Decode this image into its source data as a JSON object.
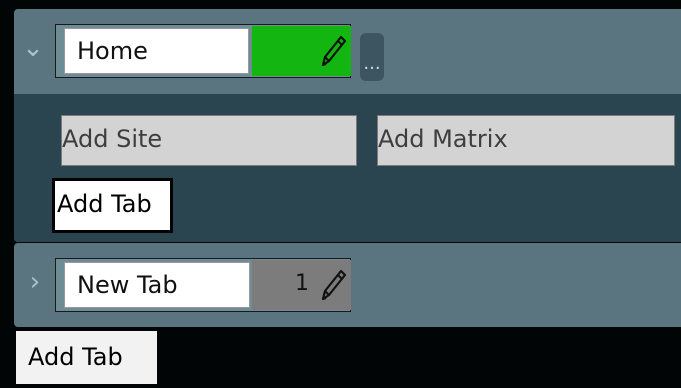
{
  "tabs": [
    {
      "name": "Home",
      "expanded": true,
      "color": "#13b510",
      "count": "",
      "more_label": "...",
      "actions": {
        "add_site": "Add Site",
        "add_matrix": "Add Matrix",
        "add_tab": "Add Tab"
      }
    },
    {
      "name": "New Tab",
      "expanded": false,
      "color": "#7c7c7c",
      "count": "1"
    }
  ],
  "footer": {
    "add_tab": "Add Tab"
  },
  "icons": {
    "expand": "chevron-down-icon",
    "collapse": "chevron-right-icon",
    "edit": "pencil-icon"
  }
}
